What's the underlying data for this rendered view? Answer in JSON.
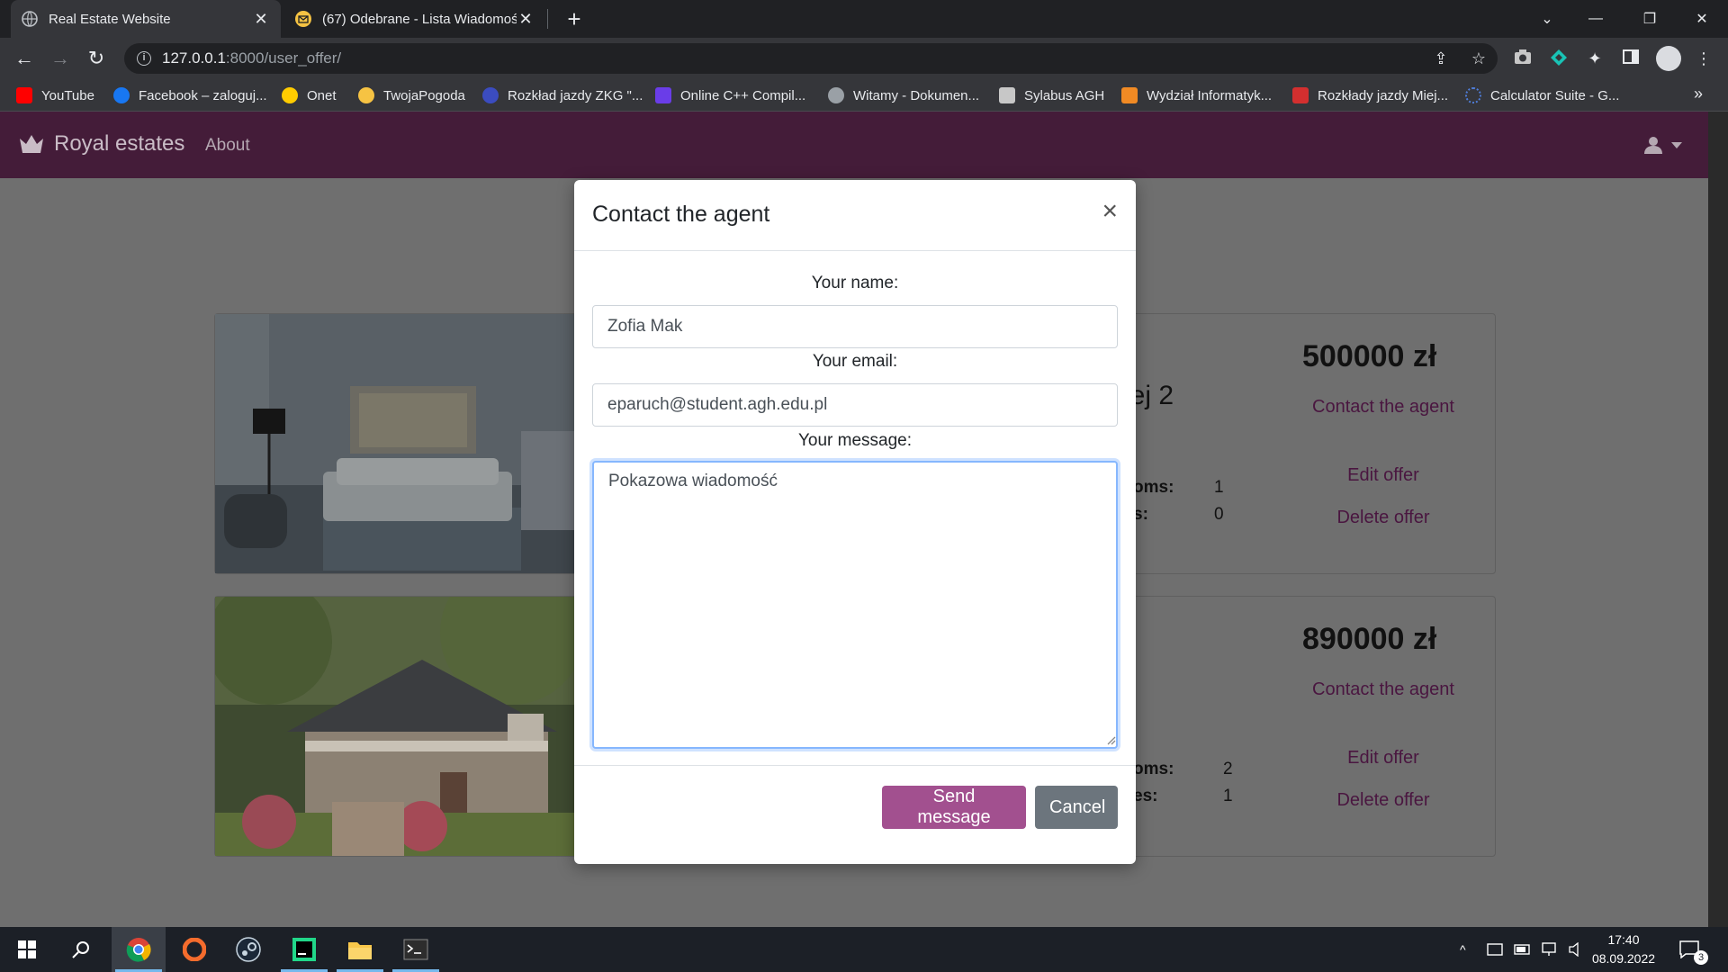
{
  "browser": {
    "tabs": [
      {
        "title": "Real Estate Website",
        "close": "✕",
        "active": true
      },
      {
        "title": "(67) Odebrane - Lista Wiadomości",
        "close": "✕",
        "active": false
      }
    ],
    "new_tab": "+",
    "url_host": "127.0.0.1",
    "url_rest": ":8000/user_offer/",
    "bookmarks": [
      {
        "label": "YouTube",
        "icon": "youtube-icon",
        "color": "#ff0000"
      },
      {
        "label": "Facebook – zaloguj...",
        "icon": "facebook-icon",
        "color": "#1877f2"
      },
      {
        "label": "Onet",
        "icon": "onet-icon",
        "color": "#ffcc00"
      },
      {
        "label": "TwojaPogoda",
        "icon": "weather-icon",
        "color": "#f6c343"
      },
      {
        "label": "Rozkład jazdy ZKG \"...",
        "icon": "bus-icon",
        "color": "#3b4cc0"
      },
      {
        "label": "Online C++ Compil...",
        "icon": "compiler-icon",
        "color": "#6a3de8"
      },
      {
        "label": "Witamy - Dokumen...",
        "icon": "globe-icon",
        "color": "#9aa0a6"
      },
      {
        "label": "Sylabus AGH",
        "icon": "sylabus-icon",
        "color": "#c7c7c7"
      },
      {
        "label": "Wydział Informatyk...",
        "icon": "wi-icon",
        "color": "#f08a24"
      },
      {
        "label": "Rozkłady jazdy Miej...",
        "icon": "mpk-icon",
        "color": "#d32f2f"
      },
      {
        "label": "Calculator Suite - G...",
        "icon": "calculator-icon",
        "color": "#4f7dd9"
      }
    ],
    "bookmarks_more": "»"
  },
  "site": {
    "brand": "Royal estates",
    "nav": {
      "about": "About"
    },
    "accent": "#441c39"
  },
  "offers": [
    {
      "title_fragment": "iej 2",
      "price": "500000 zł",
      "specs": [
        {
          "label_fragment": "oms:",
          "value": "1"
        },
        {
          "label_fragment": "s:",
          "value": "0"
        }
      ],
      "actions": {
        "contact": "Contact the agent",
        "edit": "Edit offer",
        "delete": "Delete offer"
      }
    },
    {
      "price": "890000 zł",
      "specs": [
        {
          "label_fragment": "oms:",
          "value": "2"
        },
        {
          "label_fragment": "es:",
          "value": "1"
        }
      ],
      "actions": {
        "contact": "Contact the agent",
        "edit": "Edit offer",
        "delete": "Delete offer"
      }
    }
  ],
  "modal": {
    "title": "Contact the agent",
    "close": "×",
    "name_label": "Your name:",
    "name_value": "Zofia Mak",
    "email_label": "Your email:",
    "email_value": "eparuch@student.agh.edu.pl",
    "message_label": "Your message:",
    "message_value": "Pokazowa wiadomość",
    "send_label": "Send message",
    "cancel_label": "Cancel",
    "send_color": "#a2508f",
    "cancel_color": "#6c757d"
  },
  "taskbar": {
    "time": "17:40",
    "date": "08.09.2022",
    "notifications": "3"
  }
}
